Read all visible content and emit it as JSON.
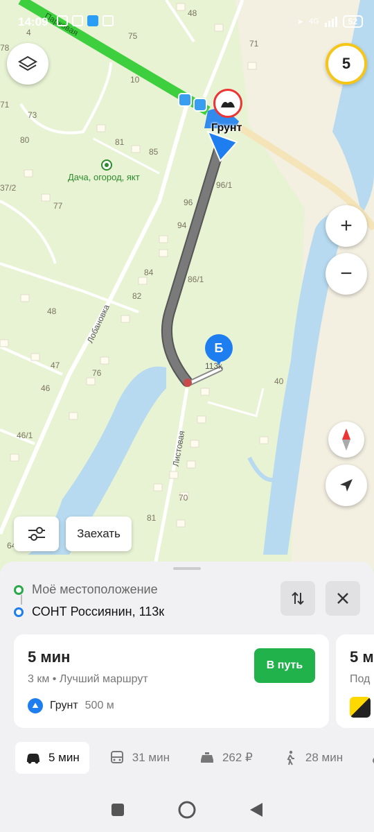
{
  "status": {
    "time": "14:09",
    "battery": "52",
    "network": "4G"
  },
  "map": {
    "speed_limit": "5",
    "road_labels": {
      "parkovaya": "Парковая",
      "lobanovka": "Лобановка",
      "listovaya": "Листовая"
    },
    "poi": "Дача, огород, якт",
    "hazard_label": "Грунт",
    "destination_pin": "Б",
    "destination_house": "113к",
    "house_numbers": [
      "4",
      "48",
      "75",
      "71",
      "10",
      "78",
      "71",
      "73",
      "80",
      "81",
      "85",
      "37/2",
      "77",
      "96/1",
      "96",
      "94",
      "84",
      "86/1",
      "82",
      "48",
      "47",
      "76",
      "46",
      "40",
      "46/1",
      "70",
      "81",
      "64"
    ]
  },
  "controls": {
    "zoom_in": "+",
    "zoom_out": "−",
    "settings_button": "",
    "drive_in_button": "Заехать"
  },
  "route": {
    "from": "Моё местоположение",
    "to": "СОНТ Россиянин, 113к",
    "card": {
      "time": "5 мин",
      "subtitle": "3 км • Лучший маршрут",
      "ground": "Грунт",
      "ground_distance": "500 м",
      "go_button": "В путь"
    },
    "card2": {
      "time": "5 м",
      "subtitle": "Под"
    }
  },
  "modes": [
    {
      "label": "5 мин",
      "icon": "car-icon"
    },
    {
      "label": "31 мин",
      "icon": "bus-icon"
    },
    {
      "label": "262 ₽",
      "icon": "taxi-icon"
    },
    {
      "label": "28 мин",
      "icon": "walk-icon"
    }
  ],
  "colors": {
    "route": "#7a7a7a",
    "accent": "#1e7ef0",
    "go": "#21b24c",
    "traffic": "#3ecf3e"
  }
}
